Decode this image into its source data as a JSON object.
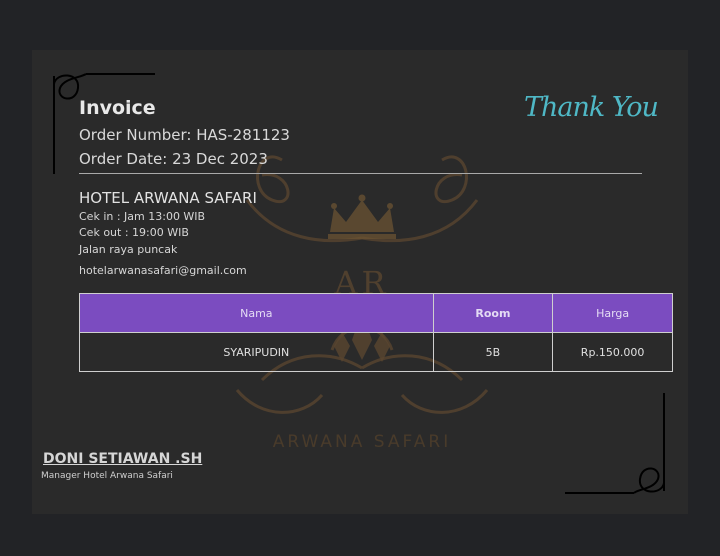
{
  "invoice": {
    "title": "Invoice",
    "order_number": "Order Number: HAS-281123",
    "order_date": "Order Date: 23 Dec 2023",
    "thank_you": "Thank You"
  },
  "hotel": {
    "name": "HOTEL ARWANA SAFARI",
    "checkin": "Cek in : Jam 13:00 WIB",
    "checkout": "Cek out : 19:00 WIB",
    "address": "Jalan raya puncak",
    "email": "hotelarwanasafari@gmail.com"
  },
  "watermark": {
    "initials": "AR",
    "text": "ARWANA SAFARI"
  },
  "table": {
    "headers": [
      "Nama",
      "Room",
      "Harga"
    ],
    "rows": [
      [
        "SYARIPUDIN",
        "5B",
        "Rp.150.000"
      ]
    ]
  },
  "signature": {
    "name": "DONI SETIAWAN .SH",
    "title": "Manager Hotel Arwana Safari"
  },
  "colors": {
    "background": "#222326",
    "card": "#2a2a2a",
    "header_purple": "#7b4cc0",
    "thank_you_teal": "#4fb8c6",
    "watermark_gold": "#6b5332"
  }
}
